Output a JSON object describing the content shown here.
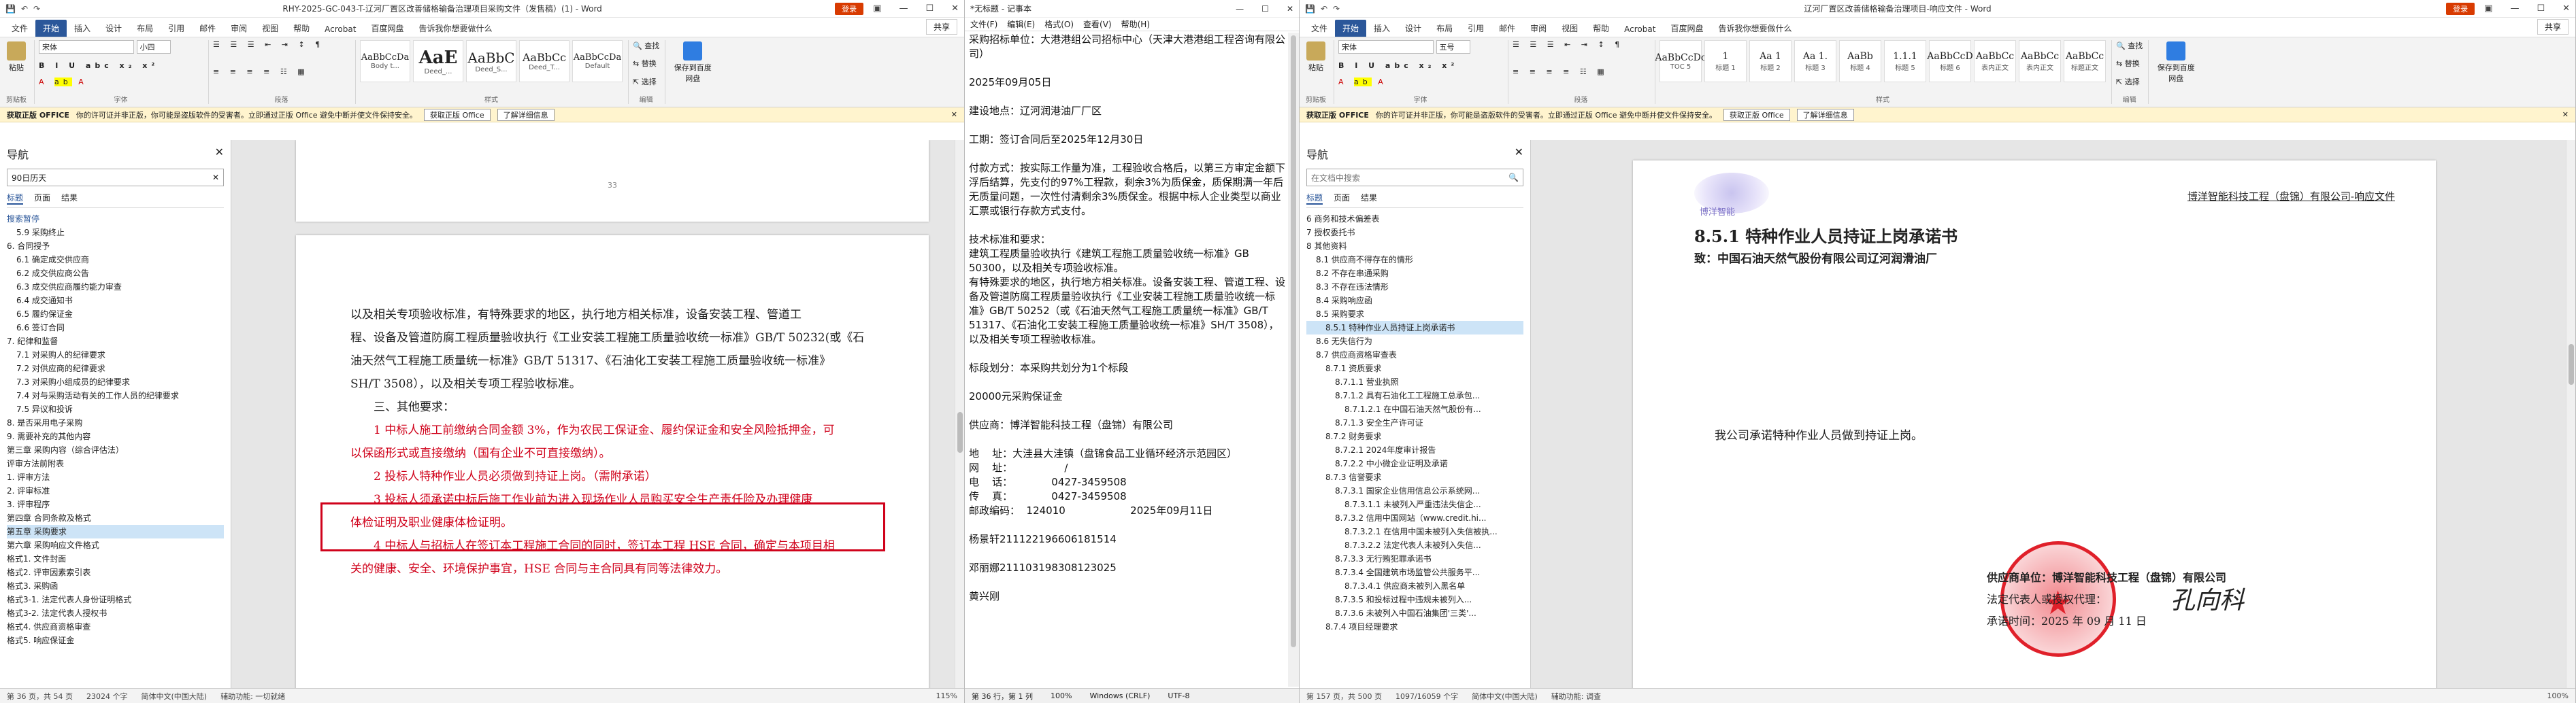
{
  "left_window": {
    "title": "RHY-2025-GC-043-T-辽河厂置区改善储格输备治理项目采购文件（发售稿）(1) - Word",
    "login": "登录",
    "share": "共享",
    "tabs": [
      "文件",
      "开始",
      "插入",
      "设计",
      "布局",
      "引用",
      "邮件",
      "审阅",
      "视图",
      "帮助",
      "Acrobat",
      "百度网盘",
      "告诉我你想要做什么"
    ],
    "font_name": "宋体",
    "font_size": "小四",
    "styles": [
      {
        "sample": "AaBbCcDa",
        "name": "Body t..."
      },
      {
        "sample": "AaE",
        "name": "Deed_..."
      },
      {
        "sample": "AaBbC",
        "name": "Deed_S..."
      },
      {
        "sample": "AaBbCc",
        "name": "Deed_T..."
      },
      {
        "sample": "AaBbCcDa",
        "name": "Default"
      }
    ],
    "ribbon_groups": [
      "剪贴板",
      "字体",
      "段落",
      "样式",
      "编辑",
      "保存",
      "保存到百度网盘"
    ],
    "paste_label": "粘贴",
    "find_label": "查找",
    "replace_label": "替换",
    "select_label": "选择",
    "save_baidu": "保存到百度网盘",
    "notice": {
      "title": "获取正版 OFFICE",
      "text": "你的许可证并非正版，你可能是盗版软件的受害者。立即通过正版 Office 避免中断并使文件保持安全。",
      "btn1": "获取正版 Office",
      "btn2": "了解详细信息"
    },
    "nav": {
      "title": "导航",
      "search": "90日历天",
      "tabs": [
        "标题",
        "页面",
        "结果"
      ],
      "search_label": "搜索暂停",
      "items": [
        "5.9 采购终止",
        "6. 合同授予",
        "6.1 确定成交供应商",
        "6.2 成交供应商公告",
        "6.3 成交供应商履约能力审查",
        "6.4 成交通知书",
        "6.5 履约保证金",
        "6.6 签订合同",
        "7. 纪律和监督",
        "7.1 对采购人的纪律要求",
        "7.2 对供应商的纪律要求",
        "7.3 对采购小组成员的纪律要求",
        "7.4 对与采购活动有关的工作人员的纪律要求",
        "7.5 异议和投诉",
        "8. 是否采用电子采购",
        "9. 需要补充的其他内容",
        "第三章 采购内容（综合评估法）",
        "评审方法前附表",
        "1. 评审方法",
        "2. 评审标准",
        "3. 评审程序",
        "第四章 合同条款及格式",
        "第五章 采购要求",
        "第六章 采购响应文件格式",
        "格式1. 文件封面",
        "格式2. 评审因素索引表",
        "格式3. 采购函",
        "格式3-1. 法定代表人身份证明格式",
        "格式3-2. 法定代表人授权书",
        "格式4. 供应商资格审查",
        "格式5. 响应保证金"
      ],
      "selected_index": 22
    },
    "page_num": "33",
    "doc_lines": [
      "以及相关专项验收标准，有特殊要求的地区，执行地方相关标准，设备安装工程、管道工",
      "程、设备及管道防腐工程质量验收执行《工业安装工程施工质量验收统一标准》GB/T 50232(或《石",
      "油天然气工程施工质量统一标准》GB/T 51317、《石油化工安装工程施工质量验收统一标准》",
      "SH/T 3508），以及相关专项工程验收标准。"
    ],
    "other_req": "三、其他要求：",
    "req_lines": [
      "1 中标人施工前缴纳合同金额 3%，作为农民工保证金、履约保证金和安全风险抵押金，可",
      "以保函形式或直接缴纳（国有企业不可直接缴纳）。",
      "2 投标人特种作业人员必须做到持证上岗。（需附承诺）",
      "3 投标人须承诺中标后施工作业前为进入现场作业人员购买安全生产责任险及办理健康",
      "体检证明及职业健康体检证明。",
      "4 中标人与招标人在签订本工程施工合同的同时，签订本工程 HSE 合同，确定与本项目相",
      "关的健康、安全、环境保护事宜，HSE 合同与主合同具有同等法律效力。"
    ],
    "status": [
      "第 36 页，共 54 页",
      "23024 个字",
      "简体中文(中国大陆)",
      "辅助功能: 一切就绪"
    ],
    "zoom": "115%"
  },
  "notepad": {
    "title": "*无标题 - 记事本",
    "menu": [
      "文件(F)",
      "编辑(E)",
      "格式(O)",
      "查看(V)",
      "帮助(H)"
    ],
    "lines": [
      "采购招标单位：大港港组公司招标中心（天津大港港组工程咨询有限公司）",
      "",
      "2025年09月05日",
      "",
      "建设地点：辽河润港油厂厂区",
      "",
      "工期：签订合同后至2025年12月30日",
      "",
      "付款方式：按实际工作量为准，工程验收合格后，以第三方审定金额下浮后结算，先支付的97%工程款，剩余3%为质保金，质保期满一年后无质量问题，一次性付清剩余3%质保金。根据中标人企业类型以商业汇票或银行存款方式支付。",
      "",
      "技术标准和要求：",
      "建筑工程质量验收执行《建筑工程施工质量验收统一标准》GB 50300，以及相关专项验收标准。",
      "有特殊要求的地区，执行地方相关标准。设备安装工程、管道工程、设备及管道防腐工程质量验收执行《工业安装工程施工质量验收统一标准》GB/T 50252（或《石油天然气工程施工质量统一标准》GB/T 51317、《石油化工安装工程施工质量验收统一标准》SH/T 3508），以及相关专项工程验收标准。",
      "",
      "标段划分：本采购共划分为1个标段",
      "",
      "20000元采购保证金",
      "",
      "供应商：博洋智能科技工程（盘锦）有限公司",
      "",
      "地    址：大洼县大洼镇（盘锦食品工业循环经济示范园区）",
      "网    址：                /",
      "电    话：            0427-3459508",
      "传    真：            0427-3459508",
      "邮政编码：  124010                    2025年09月11日",
      "",
      "杨景轩211122196606181514",
      "",
      "邓丽娜211103198308123025",
      "",
      "黄兴刚"
    ],
    "status": [
      "第 36 行，第 1 列",
      "100%",
      "Windows (CRLF)",
      "UTF-8"
    ]
  },
  "right_window": {
    "title": "辽河厂置区改善储格输备治理项目-响应文件 - Word",
    "login": "登录",
    "share": "共享",
    "tabs": [
      "文件",
      "开始",
      "插入",
      "设计",
      "布局",
      "引用",
      "邮件",
      "审阅",
      "视图",
      "帮助",
      "Acrobat",
      "百度网盘",
      "告诉我你想要做什么"
    ],
    "font_name": "宋体",
    "font_size": "五号",
    "styles": [
      {
        "sample": "AaBbCcDc",
        "name": "TOC 5"
      },
      {
        "sample": "1",
        "name": "标题 1"
      },
      {
        "sample": "Aa 1",
        "name": "标题 2"
      },
      {
        "sample": "Aa 1.",
        "name": "标题 3"
      },
      {
        "sample": "AaBb",
        "name": "标题 4"
      },
      {
        "sample": "1.1.1",
        "name": "标题 5"
      },
      {
        "sample": "AaBbCcD",
        "name": "标题 6"
      },
      {
        "sample": "AaBbCc",
        "name": "表内正文"
      },
      {
        "sample": "AaBbCc",
        "name": "表内正文"
      },
      {
        "sample": "AaBbCc",
        "name": "标题正文"
      }
    ],
    "notice": {
      "title": "获取正版 OFFICE",
      "text": "你的许可证并非正版，你可能是盗版软件的受害者。立即通过正版 Office 避免中断并使文件保持安全。",
      "btn1": "获取正版 Office",
      "btn2": "了解详细信息"
    },
    "nav": {
      "title": "导航",
      "search": "在文档中搜索",
      "tabs": [
        "标题",
        "页面",
        "结果"
      ],
      "items": [
        "6 商务和技术偏差表",
        "7 授权委托书",
        "8 其他资料",
        "8.1 供应商不得存在的情形",
        "8.2 不存在串通采购",
        "8.3 不存在违法情形",
        "8.4 采购响应函",
        "8.5 采购要求",
        "8.5.1 特种作业人员持证上岗承诺书",
        "8.6 无失信行为",
        "8.7 供应商资格审查表",
        "8.7.1 资质要求",
        "8.7.1.1 营业执照",
        "8.7.1.2 具有石油化工工程施工总承包...",
        "8.7.1.2.1 在中国石油天然气股份有...",
        "8.7.1.3 安全生产许可证",
        "8.7.2 财务要求",
        "8.7.2.1 2024年度审计报告",
        "8.7.2.2 中小微企业证明及承诺",
        "8.7.3 信誉要求",
        "8.7.3.1 国家企业信用信息公示系统网...",
        "8.7.3.1.1 未被列入严重违法失信企...",
        "8.7.3.2 信用中国网站（www.credit.hi...",
        "8.7.3.2.1 在信用中国未被列入失信被执...",
        "8.7.3.2.2 法定代表人未被列入失信...",
        "8.7.3.3 无行贿犯罪承诺书",
        "8.7.3.4 全国建筑市场监管公共服务平...",
        "8.7.3.4.1 供应商未被列入黑名单",
        "8.7.3.5 和投标过程中违规未被列入...",
        "8.7.3.6 未被列入中国石油集团'三类'...",
        "8.7.4 项目经理要求"
      ],
      "selected_index": 8
    },
    "logo_text": "博洋智能",
    "header_company": "博洋智能科技工程（盘锦）有限公司-响应文件",
    "heading": "8.5.1  特种作业人员持证上岗承诺书",
    "to_line": "致：中国石油天然气股份有限公司辽河润滑油厂",
    "promise": "我公司承诺特种作业人员做到持证上岗。",
    "sign_unit": "供应商单位：博洋智能科技工程（盘锦）有限公司",
    "sign_rep": "法定代表人或授权代理：",
    "sign_date": "承诺时间：2025 年 09 月 11 日",
    "signature": "孔向科",
    "status": [
      "第 157 页，共 500 页",
      "1097/16059 个字",
      "简体中文(中国大陆)",
      "辅助功能: 调查"
    ],
    "zoom": "100%"
  },
  "colors": {
    "word_blue": "#2b579a",
    "highlight_red": "#d0021b",
    "notice_bg": "#fff4ce",
    "seal_red": "#e0202a"
  }
}
